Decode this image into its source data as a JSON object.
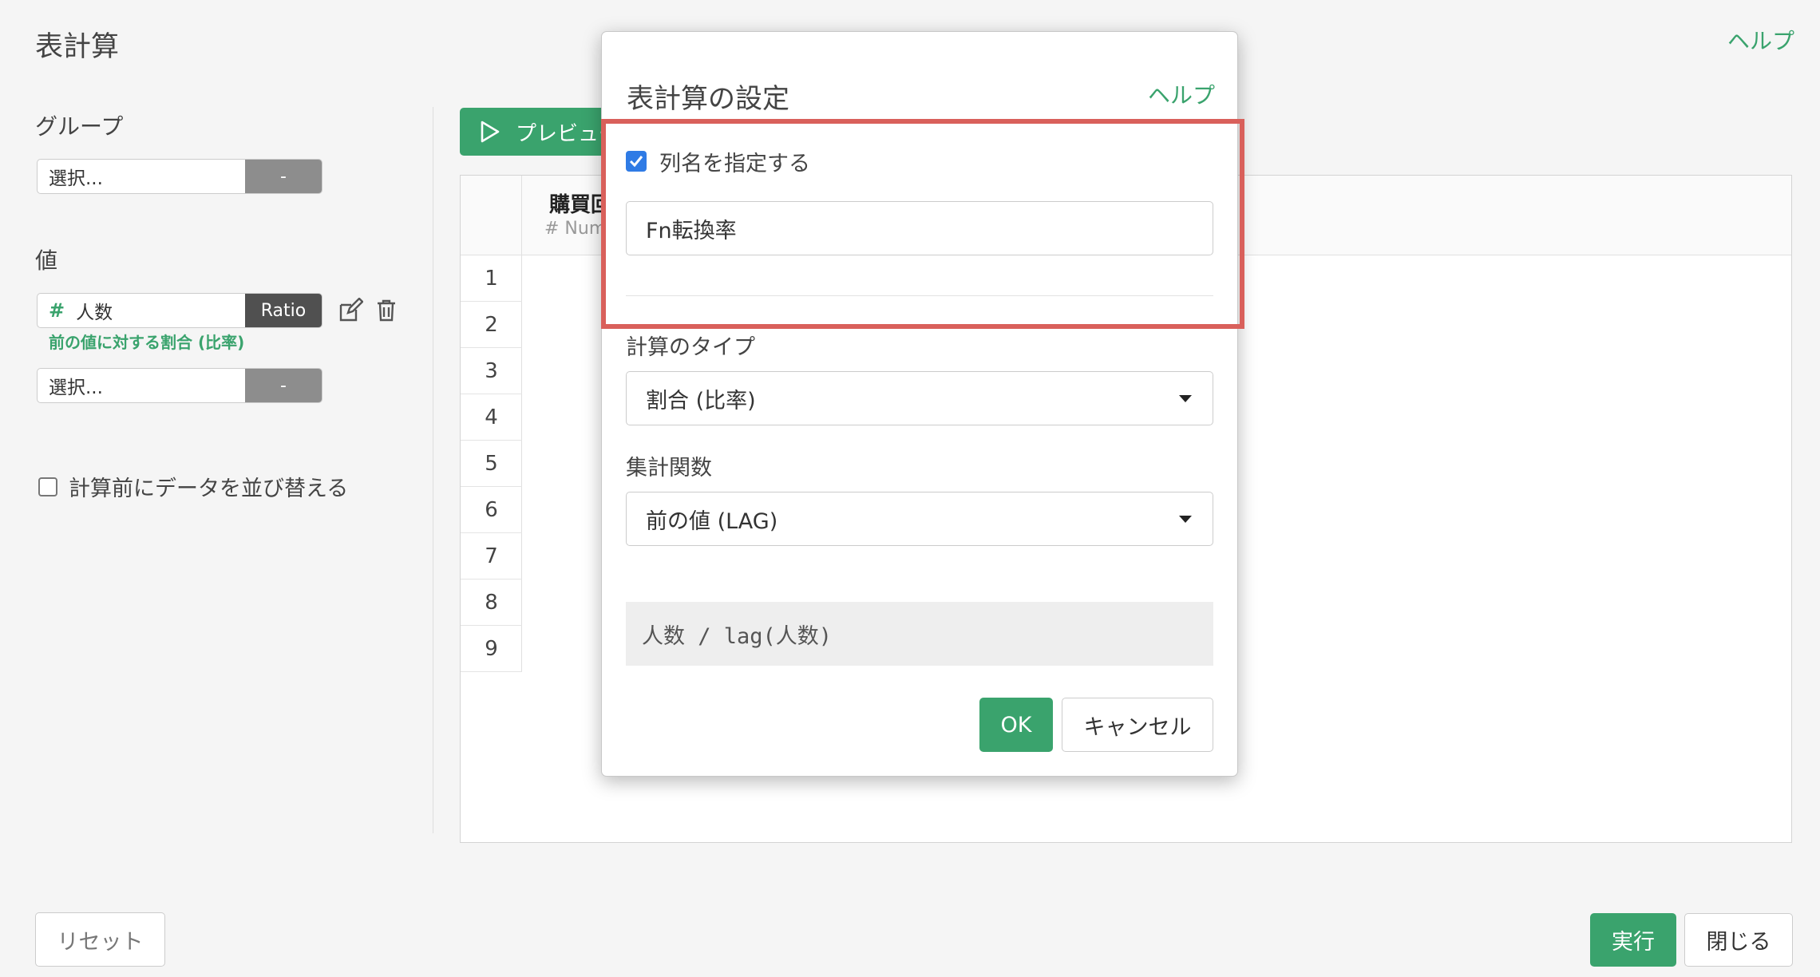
{
  "page": {
    "title": "表計算",
    "help": "ヘルプ"
  },
  "sidebar": {
    "group_label": "グループ",
    "group_select": {
      "placeholder": "選択...",
      "button": "-"
    },
    "value_label": "値",
    "value_item": {
      "type_icon": "#",
      "column": "人数",
      "button": "Ratio",
      "note": "前の値に対する割合 (比率)"
    },
    "value_select": {
      "placeholder": "選択...",
      "button": "-"
    },
    "sort_checkbox_label": "計算前にデータを並び替える"
  },
  "preview": {
    "button_label": "プレビュー",
    "column_header": "購買回",
    "column_type": "# Num",
    "row_numbers": [
      "1",
      "2",
      "3",
      "4",
      "5",
      "6",
      "7",
      "8",
      "9"
    ]
  },
  "footer": {
    "reset": "リセット",
    "run": "実行",
    "close": "閉じる"
  },
  "dialog": {
    "title": "表計算の設定",
    "help": "ヘルプ",
    "specify_name_label": "列名を指定する",
    "specify_name_checked": true,
    "column_name_value": "Fn転換率",
    "calc_type_label": "計算のタイプ",
    "calc_type_value": "割合 (比率)",
    "agg_func_label": "集計関数",
    "agg_func_value": "前の値 (LAG)",
    "formula": "人数 / lag(人数)",
    "ok": "OK",
    "cancel": "キャンセル"
  },
  "colors": {
    "accent": "#3aa36d",
    "highlight": "#d9605b",
    "checkbox": "#2f7be5"
  }
}
